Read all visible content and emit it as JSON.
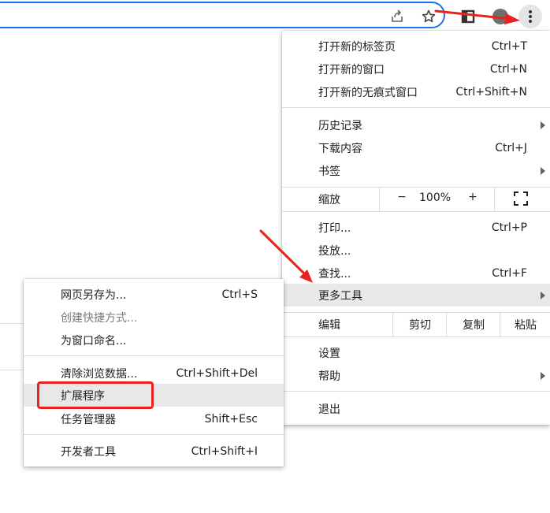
{
  "toolbar": {
    "icons": [
      "share-icon",
      "bookmark-star-icon",
      "extension-icon",
      "profile-icon",
      "more-menu-icon"
    ]
  },
  "main_menu": {
    "items": [
      {
        "label": "打开新的标签页",
        "shortcut": "Ctrl+T"
      },
      {
        "label": "打开新的窗口",
        "shortcut": "Ctrl+N"
      },
      {
        "label": "打开新的无痕式窗口",
        "shortcut": "Ctrl+Shift+N"
      },
      {
        "label": "历史记录",
        "shortcut": ""
      },
      {
        "label": "下载内容",
        "shortcut": "Ctrl+J"
      },
      {
        "label": "书签",
        "shortcut": ""
      },
      {
        "label": "打印...",
        "shortcut": "Ctrl+P"
      },
      {
        "label": "投放...",
        "shortcut": ""
      },
      {
        "label": "查找...",
        "shortcut": "Ctrl+F"
      },
      {
        "label": "更多工具",
        "shortcut": ""
      },
      {
        "label": "设置",
        "shortcut": ""
      },
      {
        "label": "帮助",
        "shortcut": ""
      },
      {
        "label": "退出",
        "shortcut": ""
      }
    ],
    "zoom": {
      "label": "缩放",
      "minus": "−",
      "value": "100%",
      "plus": "+"
    },
    "edit": {
      "label": "编辑",
      "cut": "剪切",
      "copy": "复制",
      "paste": "粘贴"
    }
  },
  "sub_menu": {
    "items": [
      {
        "label": "网页另存为...",
        "shortcut": "Ctrl+S"
      },
      {
        "label": "创建快捷方式...",
        "shortcut": ""
      },
      {
        "label": "为窗口命名...",
        "shortcut": ""
      },
      {
        "label": "清除浏览数据...",
        "shortcut": "Ctrl+Shift+Del"
      },
      {
        "label": "扩展程序",
        "shortcut": ""
      },
      {
        "label": "任务管理器",
        "shortcut": "Shift+Esc"
      },
      {
        "label": "开发者工具",
        "shortcut": "Ctrl+Shift+I"
      }
    ]
  },
  "colors": {
    "accent": "#1a73e8",
    "annotation_red": "#e8231f",
    "hover": "#e8e8e8"
  }
}
